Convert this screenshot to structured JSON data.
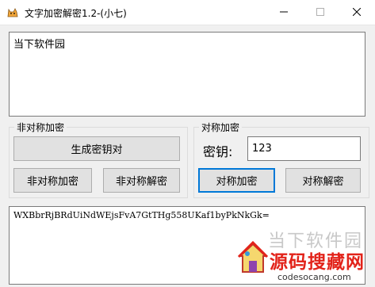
{
  "window": {
    "title": "文字加密解密1.2-(小七)"
  },
  "input": {
    "value": "当下软件园"
  },
  "asymmetric_group": {
    "legend": "非对称加密",
    "generate_label": "生成密钥对",
    "encrypt_label": "非对称加密",
    "decrypt_label": "非对称解密"
  },
  "symmetric_group": {
    "legend": "对称加密",
    "key_label": "密钥:",
    "key_value": "123",
    "encrypt_label": "对称加密",
    "decrypt_label": "对称解密"
  },
  "output": {
    "value": "WXBbrRjBRdUiNdWEjsFvA7GtTHg558UKaf1byPkNkGk="
  },
  "watermark": {
    "faded_text": "当下软件园",
    "brand": "源码搜藏网",
    "url": "codesocang.com"
  },
  "colors": {
    "accent_focus": "#0078d7",
    "watermark_red": "#e2231a"
  }
}
